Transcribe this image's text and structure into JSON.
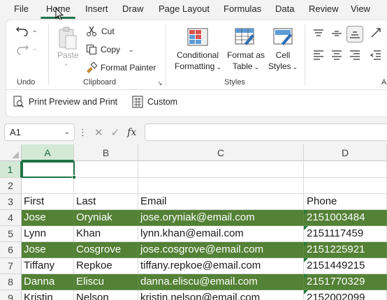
{
  "menu": {
    "tabs": [
      "File",
      "Home",
      "Insert",
      "Draw",
      "Page Layout",
      "Formulas",
      "Data",
      "Review",
      "View"
    ],
    "active_tab": "Home"
  },
  "ribbon": {
    "undo": {
      "group_label": "Undo"
    },
    "clipboard": {
      "paste_label": "Paste",
      "cut_label": "Cut",
      "copy_label": "Copy",
      "format_painter_label": "Format Painter",
      "group_label": "Clipboard"
    },
    "styles": {
      "conditional_formatting": [
        "Conditional",
        "Formatting"
      ],
      "format_as_table": [
        "Format as",
        "Table"
      ],
      "cell_styles": [
        "Cell",
        "Styles"
      ],
      "group_label": "Styles"
    },
    "alignment": {
      "group_label": "A"
    },
    "quick_access": {
      "print_preview_label": "Print Preview and Print",
      "custom_label": "Custom"
    }
  },
  "formula_bar": {
    "name_box": "A1",
    "fx_label": "fx",
    "formula": ""
  },
  "sheet": {
    "columns": [
      "A",
      "B",
      "C",
      "D"
    ],
    "selected_column": "A",
    "rows": [
      "1",
      "2",
      "3",
      "4",
      "5",
      "6",
      "7",
      "8",
      "9"
    ],
    "selected_row": "1",
    "header": {
      "first": "First",
      "last": "Last",
      "email": "Email",
      "phone": "Phone"
    },
    "records": [
      {
        "first": "Jose",
        "last": "Oryniak",
        "email": "jose.oryniak@email.com",
        "phone": "2151003484",
        "highlighted": true
      },
      {
        "first": "Lynn",
        "last": "Khan",
        "email": "lynn.khan@email.com",
        "phone": "2151117459",
        "highlighted": false
      },
      {
        "first": "Jose",
        "last": "Cosgrove",
        "email": "jose.cosgrove@email.com",
        "phone": "2151225921",
        "highlighted": true
      },
      {
        "first": "Tiffany",
        "last": "Repkoe",
        "email": "tiffany.repkoe@email.com",
        "phone": "2151449215",
        "highlighted": false
      },
      {
        "first": "Danna",
        "last": "Eliscu",
        "email": "danna.eliscu@email.com",
        "phone": "2151770329",
        "highlighted": true
      },
      {
        "first": "Kristin",
        "last": "Nelson",
        "email": "kristin.nelson@email.com",
        "phone": "2152002099",
        "highlighted": false
      }
    ],
    "highlight_color": "#538135",
    "accent_color": "#217346"
  }
}
